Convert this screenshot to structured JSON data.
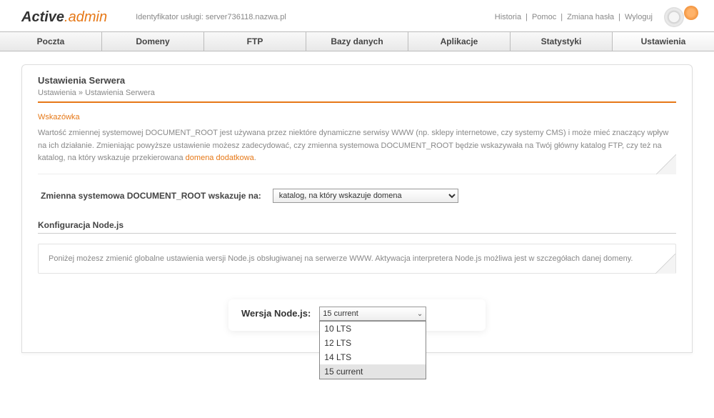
{
  "logo": {
    "part1": "Active",
    "part2": ".admin"
  },
  "service": {
    "label": "Identyfikator usługi:",
    "value": "server736118.nazwa.pl"
  },
  "top_links": [
    "Historia",
    "Pomoc",
    "Zmiana hasła",
    "Wyloguj"
  ],
  "nav": [
    "Poczta",
    "Domeny",
    "FTP",
    "Bazy danych",
    "Aplikacje",
    "Statystyki",
    "Ustawienia"
  ],
  "nav_active": 6,
  "panel_title": "Ustawienia Serwera",
  "breadcrumb": {
    "root": "Ustawienia",
    "sep": "»",
    "current": "Ustawienia Serwera"
  },
  "tip": {
    "title": "Wskazówka",
    "text_before": "Wartość zmiennej systemowej DOCUMENT_ROOT jest używana przez niektóre dynamiczne serwisy WWW (np. sklepy internetowe, czy systemy CMS) i może mieć znaczący wpływ na ich działanie. Zmieniając powyższe ustawienie możesz zadecydować, czy zmienna systemowa DOCUMENT_ROOT będzie wskazywała na Twój główny katalog FTP, czy też na katalog, na który wskazuje przekierowana ",
    "link": "domena dodatkowa",
    "text_after": "."
  },
  "docroot": {
    "label": "Zmienna systemowa DOCUMENT_ROOT wskazuje na:",
    "selected": "katalog, na który wskazuje domena"
  },
  "node_section": {
    "title": "Konfiguracja Node.js",
    "info": "Poniżej możesz zmienić globalne ustawienia wersji Node.js obsługiwanej na serwerze WWW. Aktywacja interpretera Node.js możliwa jest w szczegółach danej domeny.",
    "label": "Wersja Node.js:",
    "selected": "15 current",
    "options": [
      "10 LTS",
      "12 LTS",
      "14 LTS",
      "15 current"
    ]
  }
}
